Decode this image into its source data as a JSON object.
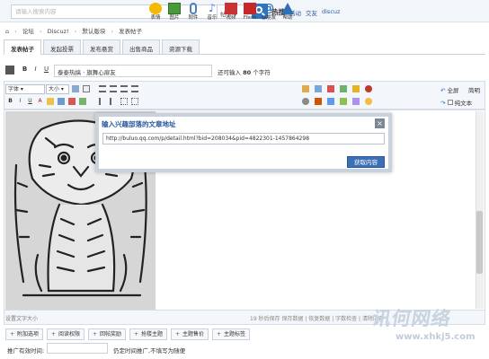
{
  "header": {
    "search_placeholder": "请输入搜索内容",
    "search_type": "帖子",
    "hot_label": "热搜:",
    "hot_links": [
      "活动",
      "交友",
      "discuz"
    ]
  },
  "breadcrumb": [
    "论坛",
    "Discuz!",
    "默认版块",
    "发表帖子"
  ],
  "tabs": [
    "发表帖子",
    "发起投票",
    "发布悬赏",
    "出售商品",
    "资源下载"
  ],
  "title_row": {
    "title_value": "泰泰热搞 · 旗舞心扉友",
    "limit_prefix": "还可输入",
    "limit_count": "80",
    "limit_suffix": "个字符"
  },
  "toolbar": {
    "font_select": "字体",
    "size_select": "大小",
    "buttons": [
      {
        "label": "表情",
        "icon": "smile-icon",
        "color": "#f5b800"
      },
      {
        "label": "图片",
        "icon": "image-icon",
        "color": "#4a9a3c"
      },
      {
        "label": "附件",
        "icon": "paperclip-icon",
        "color": "#4a7fc1"
      },
      {
        "label": "音乐",
        "icon": "music-icon",
        "color": "#3a7bd5"
      },
      {
        "label": "视频",
        "icon": "video-icon",
        "color": "#c83232"
      },
      {
        "label": "Flash",
        "icon": "flash-icon",
        "color": "#c62828"
      },
      {
        "label": "@朋友",
        "icon": "at-icon",
        "color": "#2f6fb5"
      },
      {
        "label": "帮助",
        "icon": "warning-icon",
        "color": "#2f6fb5"
      }
    ],
    "fullscreen": "全屏",
    "simple": "简明",
    "plaintext": "纯文本"
  },
  "dialog": {
    "title": "输入兴趣部落的文章地址",
    "close": "×",
    "url_value": "http://buluo.qq.com/p/detail.html?bid=208034&pid=4822301-1457864298",
    "fetch_button": "获取内容"
  },
  "status": {
    "left": "设置文字大小",
    "right": "19 秒后保存 保存数据 | 恢复数据 | 字数检查 | 清除内容"
  },
  "options": [
    "附加选项",
    "阅读权限",
    "回帖奖励",
    "抢楼主题",
    "主题售价",
    "主题标签"
  ],
  "promo": {
    "label": "推广有效时间:",
    "hint": "仍定时间推广,不填写为随便"
  },
  "watermark": {
    "text": "讯何网络",
    "url": "www.xhkj5.com"
  },
  "colors": {
    "accent": "#2e75c3",
    "link": "#2a5a9e",
    "border": "#c8d2dc"
  }
}
